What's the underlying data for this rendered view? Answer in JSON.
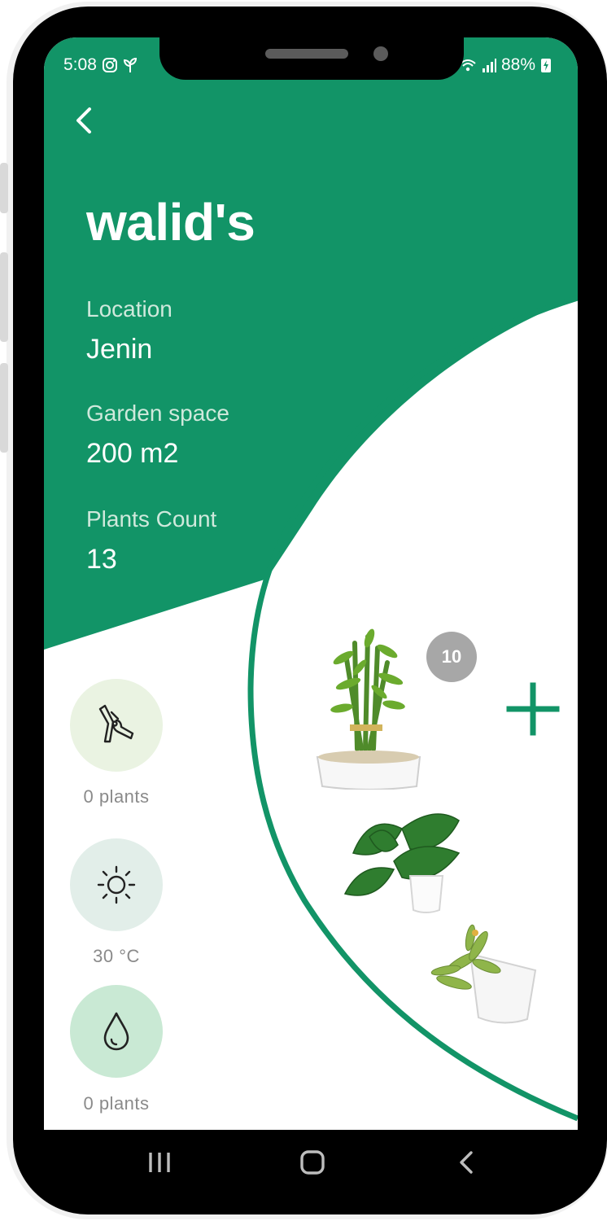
{
  "colors": {
    "brand_green": "#129467",
    "label_green": "#cfe9dc",
    "pruning_bg": "#eaf3e2",
    "sun_bg": "#e2eee9",
    "water_bg": "#c9e9d4",
    "badge_gray": "#a7a7a7",
    "caption_gray": "#8a8a8a"
  },
  "status_bar": {
    "time": "5:08",
    "battery": "88%",
    "left_icons": [
      "instagram-icon",
      "plant-notification-icon"
    ],
    "right_icons": [
      "wifi-icon",
      "signal-icon",
      "battery-charging-icon"
    ]
  },
  "header": {
    "back_icon": "chevron-left-icon",
    "title": "walid's"
  },
  "garden_info": {
    "location_label": "Location",
    "location_value": "Jenin",
    "space_label": "Garden space",
    "space_value": "200 m2",
    "count_label": "Plants Count",
    "count_value": "13"
  },
  "side_actions": [
    {
      "icon": "pruning-shears-icon",
      "caption": "0 plants"
    },
    {
      "icon": "sun-icon",
      "caption": "30 °C"
    },
    {
      "icon": "water-drop-icon",
      "caption": "0 plants"
    }
  ],
  "plants": {
    "count_badge": "10",
    "items": [
      "lucky-bamboo",
      "elephant-ear-plant",
      "succulent"
    ],
    "add_icon": "plus-icon"
  },
  "nav_bar": [
    "recent-apps-icon",
    "home-icon",
    "back-icon"
  ]
}
